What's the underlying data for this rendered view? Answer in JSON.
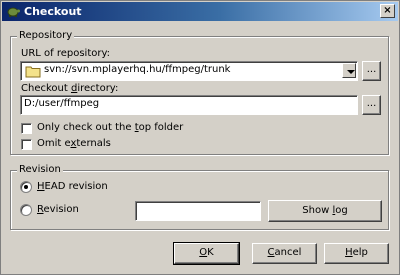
{
  "window": {
    "title": "Checkout",
    "close_glyph": "×"
  },
  "repository": {
    "group_label": "Repository",
    "url_label_prefix": "URL of repository:",
    "url_value": "svn://svn.mplayerhq.hu/ffmpeg/trunk",
    "browse_label": "...",
    "dir_label_prefix": "Checkout ",
    "dir_label_mnemonic": "d",
    "dir_label_suffix": "irectory:",
    "dir_value": "D:/user/ffmpeg",
    "dir_browse_label": "...",
    "top_folder_prefix": "Only check out the ",
    "top_folder_mnemonic": "t",
    "top_folder_suffix": "op folder",
    "omit_prefix": "Omit e",
    "omit_mnemonic": "x",
    "omit_suffix": "ternals"
  },
  "revision": {
    "group_label": "Revision",
    "head_mnemonic": "H",
    "head_suffix": "EAD revision",
    "rev_mnemonic": "R",
    "rev_suffix": "evision",
    "rev_value": "",
    "show_log_prefix": "Show ",
    "show_log_mnemonic": "l",
    "show_log_suffix": "og"
  },
  "buttons": {
    "ok_mnemonic": "O",
    "ok_suffix": "K",
    "cancel_mnemonic": "C",
    "cancel_suffix": "ancel",
    "help_mnemonic": "H",
    "help_suffix": "elp"
  }
}
